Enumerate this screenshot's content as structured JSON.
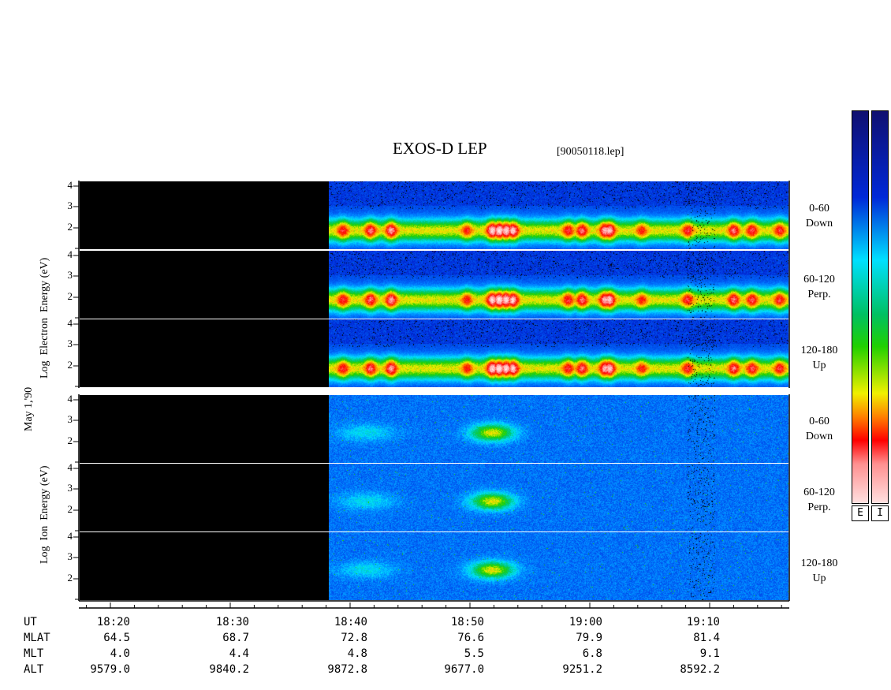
{
  "header": {
    "title": "EXOS-D LEP",
    "file": "[90050118.lep]"
  },
  "date_label": "May  1,'90",
  "electron_axis_label": [
    "Log",
    "Electron",
    "Energy",
    "(eV)"
  ],
  "ion_axis_label": [
    "Log",
    "Ion",
    "Energy",
    "(eV)"
  ],
  "panel_labels": [
    [
      "0-60",
      "Down"
    ],
    [
      "60-120",
      "Perp."
    ],
    [
      "120-180",
      "Up"
    ],
    [
      "0-60",
      "Down"
    ],
    [
      "60-120",
      "Perp."
    ],
    [
      "120-180",
      "Up"
    ]
  ],
  "ytick_labels": [
    "4",
    "3",
    "2"
  ],
  "colorbar_labels": [
    "E",
    "I"
  ],
  "chart_data": {
    "type": "heatmap",
    "title": "EXOS-D LEP",
    "subtitle": "[90050118.lep]",
    "ylabel_electron": "Log Electron Energy (eV)",
    "ylabel_ion": "Log Ion Energy (eV)",
    "y_ticks": [
      4,
      3,
      2
    ],
    "panels": [
      "0-60 Down",
      "60-120 Perp.",
      "120-180 Up",
      "0-60 Down",
      "60-120 Perp.",
      "120-180 Up"
    ],
    "data_start_ut": "18:38",
    "x_range": [
      "18:18",
      "19:17"
    ],
    "ephemeris": {
      "UT": [
        "18:20",
        "18:30",
        "18:40",
        "18:50",
        "19:00",
        "19:10"
      ],
      "MLAT": [
        "64.5",
        "68.7",
        "72.8",
        "76.6",
        "79.9",
        "81.4"
      ],
      "MLT": [
        "4.0",
        "4.4",
        "4.8",
        "5.5",
        "6.8",
        "9.1"
      ],
      "ALT": [
        "9579.0",
        "9840.2",
        "9872.8",
        "9677.0",
        "9251.2",
        "8592.2"
      ]
    }
  }
}
